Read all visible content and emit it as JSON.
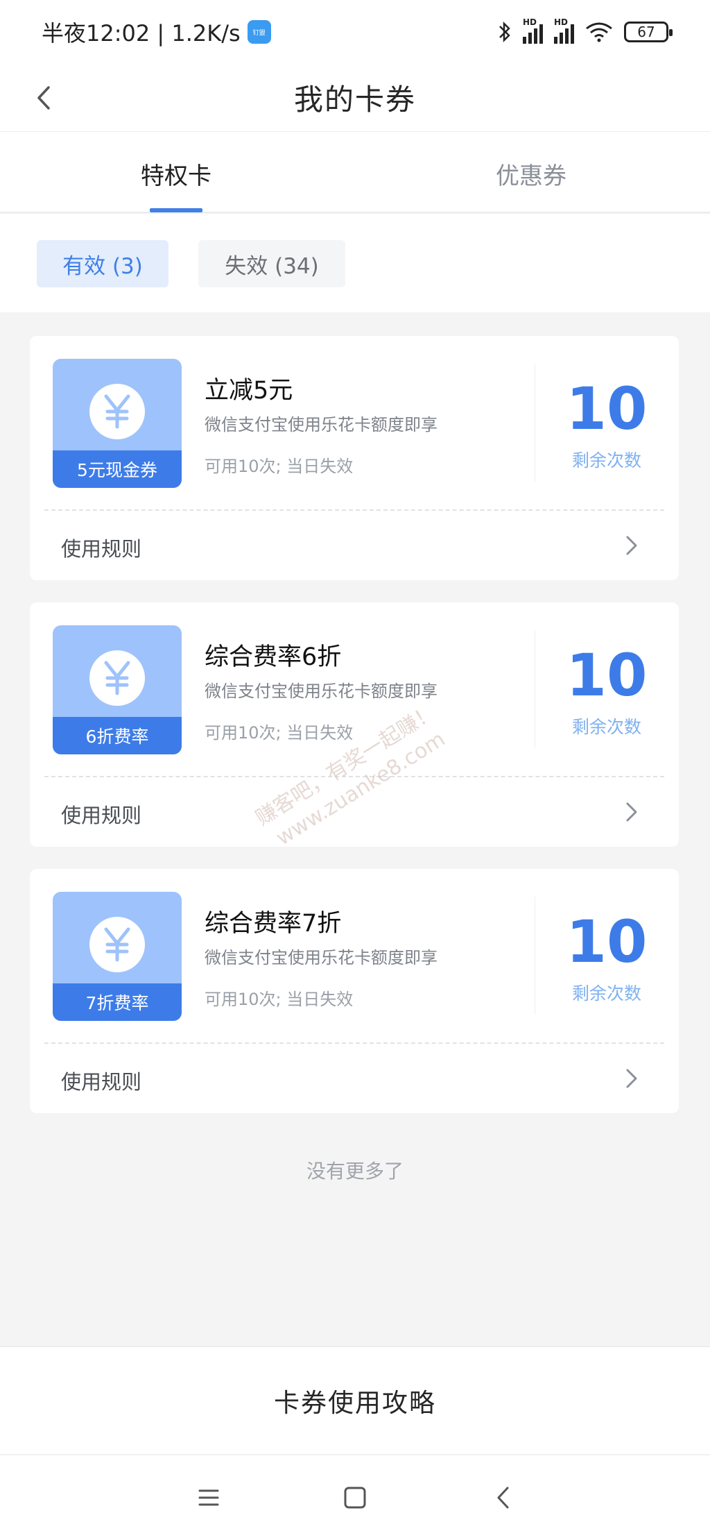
{
  "status_bar": {
    "time": "半夜12:02 | 1.2K/s",
    "app_badge": "钉盟",
    "hd1": "HD",
    "hd2": "HD",
    "battery": "67"
  },
  "header": {
    "title": "我的卡券"
  },
  "tabs": [
    {
      "label": "特权卡",
      "active": true
    },
    {
      "label": "优惠券",
      "active": false
    }
  ],
  "filters": [
    {
      "label": "有效 (3)",
      "active": true
    },
    {
      "label": "失效 (34)",
      "active": false
    }
  ],
  "cards": [
    {
      "badge_label": "5元现金券",
      "title": "立减5元",
      "description": "微信支付宝使用乐花卡额度即享",
      "usage": "可用10次; 当日失效",
      "count": "10",
      "count_label": "剩余次数",
      "rules_label": "使用规则"
    },
    {
      "badge_label": "6折费率",
      "title": "综合费率6折",
      "description": "微信支付宝使用乐花卡额度即享",
      "usage": "可用10次; 当日失效",
      "count": "10",
      "count_label": "剩余次数",
      "rules_label": "使用规则"
    },
    {
      "badge_label": "7折费率",
      "title": "综合费率7折",
      "description": "微信支付宝使用乐花卡额度即享",
      "usage": "可用10次; 当日失效",
      "count": "10",
      "count_label": "剩余次数",
      "rules_label": "使用规则"
    }
  ],
  "footer_note": "没有更多了",
  "guide": {
    "label": "卡券使用攻略"
  },
  "watermark": {
    "line1": "赚客吧，有奖一起赚！",
    "line2": "www.zuanke8.com"
  },
  "colors": {
    "accent": "#3d7ce8",
    "badge_bg": "#9ec2fb",
    "page_bg": "#f4f4f5"
  },
  "icons": [
    "back-icon",
    "yen-icon",
    "chevron-right-icon",
    "menu-icon",
    "home-icon",
    "nav-back-icon",
    "bluetooth-icon",
    "signal-icon",
    "wifi-icon",
    "battery-icon"
  ]
}
